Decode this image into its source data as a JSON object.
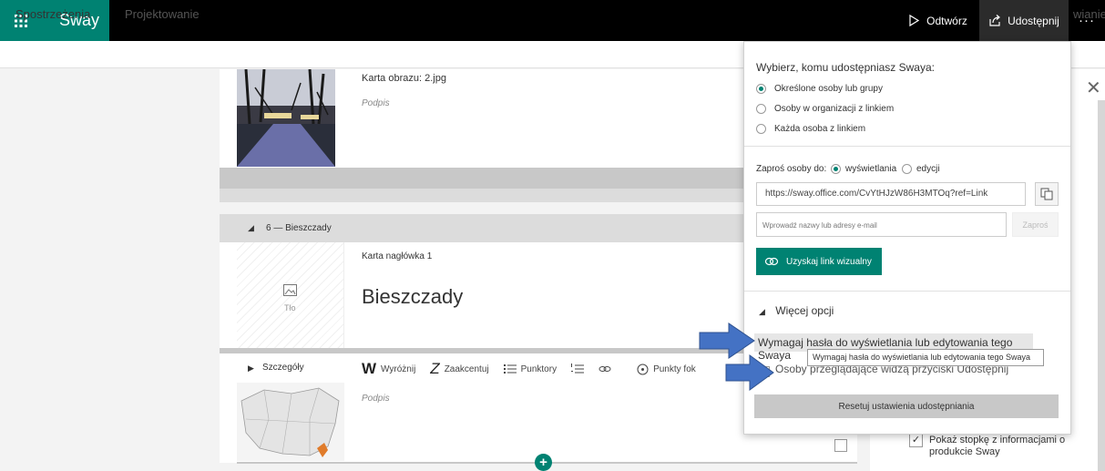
{
  "app": {
    "title": "Sway"
  },
  "header": {
    "play_label": "Odtwórz",
    "share_label": "Udostępnij",
    "more_label": "···"
  },
  "tabs": {
    "insights": "Spostrzeżenia",
    "design": "Projektowanie",
    "right_partial": "wianie"
  },
  "image_card": {
    "label": "Karta obrazu: 2.jpg",
    "caption": "Podpis"
  },
  "section": {
    "title": "6 — Bieszczady"
  },
  "heading_card": {
    "label": "Karta nagłówka 1",
    "title": "Bieszczady",
    "background_label": "Tło"
  },
  "details_card": {
    "toggle_label": "Szczegóły",
    "caption": "Podpis",
    "toolbar": {
      "emphasize": "Wyróżnij",
      "accent": "Zaakcentuj",
      "bullets": "Punktory",
      "focus_points": "Punkty fok"
    }
  },
  "share_panel": {
    "title": "Wybierz, komu udostępniasz Swaya:",
    "options": [
      {
        "label": "Określone osoby lub grupy",
        "selected": true
      },
      {
        "label": "Osoby w organizacji z linkiem",
        "selected": false
      },
      {
        "label": "Każda osoba z linkiem",
        "selected": false
      }
    ],
    "invite_label": "Zaproś osoby do:",
    "invite_view": "wyświetlania",
    "invite_edit": "edycji",
    "link": "https://sway.office.com/CvYtHJzW86H3MTOq?ref=Link",
    "email_placeholder": "Wprowadź nazwy lub adresy e-mail",
    "invite_button": "Zaproś",
    "visual_link_button": "Uzyskaj link wizualny",
    "more_options": "Więcej opcji",
    "password_option": "Wymagaj hasła do wyświetlania lub edytowania tego Swaya",
    "tooltip": "Wymagaj hasła do wyświetlania lub edytowania tego Swaya",
    "viewers_option": "Osoby przeglądające widzą przyciski Udostępnij",
    "reset_button": "Resetuj ustawienia udostępniania"
  },
  "settings_panel": {
    "footer_option": "Pokaż stopkę z informacjami o produkcie Sway",
    "footer_checked": true
  },
  "colors": {
    "accent": "#008272",
    "topbar": "#000000",
    "arrow": "#4472c4"
  }
}
